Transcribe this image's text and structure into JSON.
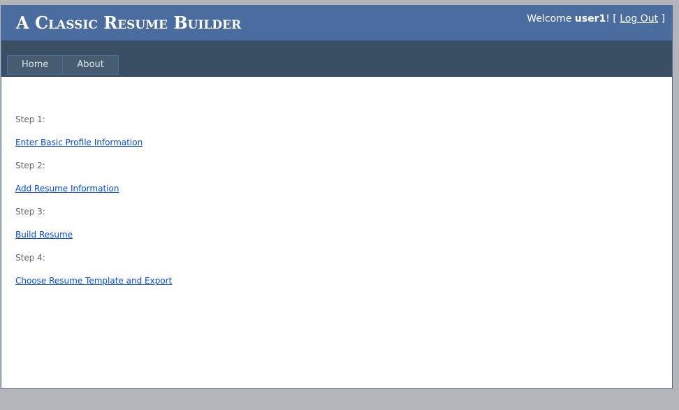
{
  "header": {
    "title": "A Classic Resume Builder",
    "welcome_prefix": "Welcome ",
    "username": "user1",
    "welcome_suffix": "! [ ",
    "logout_label": "Log Out",
    "logout_suffix": " ]"
  },
  "menu": {
    "items": [
      {
        "label": "Home"
      },
      {
        "label": "About"
      }
    ]
  },
  "steps": [
    {
      "label": "Step 1:",
      "link": "Enter Basic Profile Information"
    },
    {
      "label": "Step 2:",
      "link": "Add Resume Information"
    },
    {
      "label": "Step 3:",
      "link": "Build Resume"
    },
    {
      "label": "Step 4:",
      "link": "Choose Resume Template and Export"
    }
  ],
  "colors": {
    "header_bg": "#4b6c9e",
    "nav_bg": "#3a4f63",
    "link": "#034af3",
    "text": "#666666",
    "outer_bg": "#b4b5b9"
  }
}
